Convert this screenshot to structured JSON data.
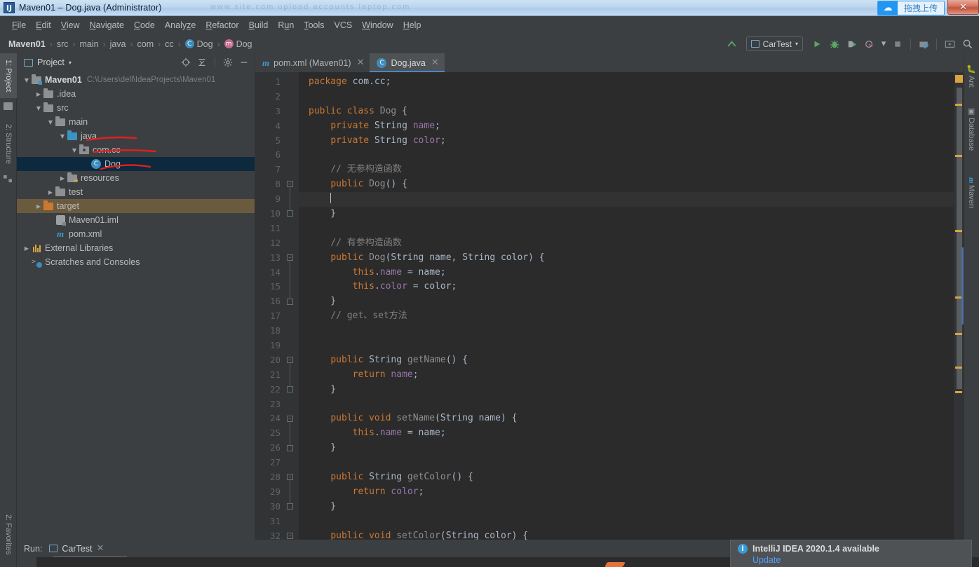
{
  "window": {
    "title": "Maven01 – Dog.java (Administrator)",
    "app_icon": "idea-icon",
    "close_label": "✕",
    "watermark": "www.site.com upload accounts laptop.com"
  },
  "upload_badge": {
    "icon": "cloud-upload-icon",
    "label": "拖拽上传"
  },
  "menubar": {
    "items": [
      {
        "label": "File",
        "accel": "F"
      },
      {
        "label": "Edit",
        "accel": "E"
      },
      {
        "label": "View",
        "accel": "V"
      },
      {
        "label": "Navigate",
        "accel": "N"
      },
      {
        "label": "Code",
        "accel": "C"
      },
      {
        "label": "Analyze",
        "accel": "z"
      },
      {
        "label": "Refactor",
        "accel": "R"
      },
      {
        "label": "Build",
        "accel": "B"
      },
      {
        "label": "Run",
        "accel": "u"
      },
      {
        "label": "Tools",
        "accel": "T"
      },
      {
        "label": "VCS",
        "accel": ""
      },
      {
        "label": "Window",
        "accel": "W"
      },
      {
        "label": "Help",
        "accel": "H"
      }
    ]
  },
  "breadcrumb": {
    "items": [
      {
        "label": "Maven01",
        "icon": "",
        "bold": true
      },
      {
        "label": "src",
        "icon": ""
      },
      {
        "label": "main",
        "icon": ""
      },
      {
        "label": "java",
        "icon": ""
      },
      {
        "label": "com",
        "icon": ""
      },
      {
        "label": "cc",
        "icon": ""
      },
      {
        "label": "Dog",
        "icon": "class-icon"
      },
      {
        "label": "Dog",
        "icon": "method-icon"
      }
    ],
    "separator": "›"
  },
  "toolbar": {
    "build_icon": "hammer-build-icon",
    "run_config": {
      "label": "CarTest",
      "icon": "run-config-icon",
      "caret": "▾"
    },
    "run_icon": "run-play-icon",
    "debug_icon": "debug-bug-icon",
    "run_coverage_icon": "run-with-coverage-icon",
    "profile_icon": "profiler-icon",
    "profile_caret": "▾",
    "stop_icon": "stop-square-icon",
    "attach_icon": "attach-debugger-icon",
    "update_icon": "update-project-icon",
    "search_icon": "search-everywhere-icon"
  },
  "left_tool_strip": {
    "tabs": [
      {
        "label": "1: Project",
        "icon": "project-icon",
        "active": true
      },
      {
        "label": "2: Structure",
        "icon": "structure-icon",
        "active": false
      }
    ],
    "bottom_tabs": [
      {
        "label": "2: Favorites",
        "icon": "favorites-icon"
      }
    ]
  },
  "right_tool_strip": {
    "tabs": [
      {
        "label": "Ant",
        "icon": "ant-icon"
      },
      {
        "label": "Database",
        "icon": "database-icon"
      },
      {
        "label": "Maven",
        "icon": "maven-icon"
      }
    ]
  },
  "project_panel": {
    "title": "Project",
    "title_caret": "▾",
    "actions": [
      {
        "name": "locate-icon",
        "glyph": "⊕"
      },
      {
        "name": "collapse-all-icon",
        "glyph": "⇥"
      },
      {
        "name": "settings-gear-icon",
        "glyph": "✾"
      },
      {
        "name": "hide-icon",
        "glyph": "—"
      }
    ],
    "tree": [
      {
        "label": "Maven01",
        "path": "C:\\Users\\dell\\IdeaProjects\\Maven01",
        "indent": 0,
        "arrow": "▼",
        "icon": "module-folder",
        "bold": true,
        "state": "normal"
      },
      {
        "label": ".idea",
        "path": "",
        "indent": 1,
        "arrow": "▶",
        "icon": "folder",
        "bold": false,
        "state": "normal"
      },
      {
        "label": "src",
        "path": "",
        "indent": 1,
        "arrow": "▼",
        "icon": "folder",
        "bold": false,
        "state": "normal"
      },
      {
        "label": "main",
        "path": "",
        "indent": 2,
        "arrow": "▼",
        "icon": "folder",
        "bold": false,
        "state": "normal"
      },
      {
        "label": "java",
        "path": "",
        "indent": 3,
        "arrow": "▼",
        "icon": "source-folder",
        "bold": false,
        "state": "normal"
      },
      {
        "label": "com.cc",
        "path": "",
        "indent": 4,
        "arrow": "▼",
        "icon": "package",
        "bold": false,
        "state": "normal"
      },
      {
        "label": "Dog",
        "path": "",
        "indent": 5,
        "arrow": "",
        "icon": "class-icon",
        "bold": false,
        "state": "selected"
      },
      {
        "label": "resources",
        "path": "",
        "indent": 3,
        "arrow": "▶",
        "icon": "resources-folder",
        "bold": false,
        "state": "normal"
      },
      {
        "label": "test",
        "path": "",
        "indent": 2,
        "arrow": "▶",
        "icon": "folder",
        "bold": false,
        "state": "normal"
      },
      {
        "label": "target",
        "path": "",
        "indent": 1,
        "arrow": "▶",
        "icon": "excluded-folder",
        "bold": false,
        "state": "highlight"
      },
      {
        "label": "Maven01.iml",
        "path": "",
        "indent": 2,
        "arrow": "",
        "icon": "iml-icon",
        "bold": false,
        "state": "normal"
      },
      {
        "label": "pom.xml",
        "path": "",
        "indent": 2,
        "arrow": "",
        "icon": "maven-pom-icon",
        "bold": false,
        "state": "normal"
      },
      {
        "label": "External Libraries",
        "path": "",
        "indent": 0,
        "arrow": "▶",
        "icon": "libraries-icon",
        "bold": false,
        "state": "normal"
      },
      {
        "label": "Scratches and Consoles",
        "path": "",
        "indent": 0,
        "arrow": "",
        "icon": "scratches-icon",
        "bold": false,
        "state": "normal"
      }
    ],
    "annotations": [
      {
        "name": "red-underline-java"
      },
      {
        "name": "red-overline-dog"
      },
      {
        "name": "red-underline-dog"
      }
    ]
  },
  "editor": {
    "tabs": [
      {
        "label": "pom.xml (Maven01)",
        "icon": "maven-pom-icon",
        "active": false,
        "close": "✕"
      },
      {
        "label": "Dog.java",
        "icon": "class-icon",
        "active": true,
        "close": "✕"
      }
    ],
    "caret_line": 9,
    "first_line": 1,
    "last_line": 32,
    "lines": [
      {
        "n": 1,
        "tokens": [
          [
            "kw",
            "package"
          ],
          [
            "pln",
            " com.cc;"
          ]
        ]
      },
      {
        "n": 2,
        "tokens": []
      },
      {
        "n": 3,
        "tokens": [
          [
            "kw",
            "public class "
          ],
          [
            "cls",
            "Dog"
          ],
          [
            "pln",
            " {"
          ]
        ]
      },
      {
        "n": 4,
        "tokens": [
          [
            "pln",
            "    "
          ],
          [
            "kw",
            "private"
          ],
          [
            "type",
            " String "
          ],
          [
            "fld",
            "name"
          ],
          [
            "pln",
            ";"
          ]
        ]
      },
      {
        "n": 5,
        "tokens": [
          [
            "pln",
            "    "
          ],
          [
            "kw",
            "private"
          ],
          [
            "type",
            " String "
          ],
          [
            "fld",
            "color"
          ],
          [
            "pln",
            ";"
          ]
        ]
      },
      {
        "n": 6,
        "tokens": []
      },
      {
        "n": 7,
        "tokens": [
          [
            "pln",
            "    "
          ],
          [
            "cmt",
            "// 无参构造函数"
          ]
        ]
      },
      {
        "n": 8,
        "tokens": [
          [
            "pln",
            "    "
          ],
          [
            "kw",
            "public "
          ],
          [
            "cls",
            "Dog"
          ],
          [
            "pln",
            "() {"
          ]
        ],
        "fold": "start"
      },
      {
        "n": 9,
        "tokens": [
          [
            "caret",
            ""
          ]
        ],
        "caret": true
      },
      {
        "n": 10,
        "tokens": [
          [
            "pln",
            "    }"
          ]
        ],
        "fold": "end"
      },
      {
        "n": 11,
        "tokens": []
      },
      {
        "n": 12,
        "tokens": [
          [
            "pln",
            "    "
          ],
          [
            "cmt",
            "// 有参构造函数"
          ]
        ]
      },
      {
        "n": 13,
        "tokens": [
          [
            "pln",
            "    "
          ],
          [
            "kw",
            "public "
          ],
          [
            "cls",
            "Dog"
          ],
          [
            "pln",
            "("
          ],
          [
            "type",
            "String"
          ],
          [
            "pln",
            " name, "
          ],
          [
            "type",
            "String"
          ],
          [
            "pln",
            " color) {"
          ]
        ],
        "fold": "start"
      },
      {
        "n": 14,
        "tokens": [
          [
            "pln",
            "        "
          ],
          [
            "kw",
            "this"
          ],
          [
            "pln",
            "."
          ],
          [
            "fld",
            "name"
          ],
          [
            "pln",
            " = name;"
          ]
        ]
      },
      {
        "n": 15,
        "tokens": [
          [
            "pln",
            "        "
          ],
          [
            "kw",
            "this"
          ],
          [
            "pln",
            "."
          ],
          [
            "fld",
            "color"
          ],
          [
            "pln",
            " = color;"
          ]
        ]
      },
      {
        "n": 16,
        "tokens": [
          [
            "pln",
            "    }"
          ]
        ],
        "fold": "end"
      },
      {
        "n": 17,
        "tokens": [
          [
            "pln",
            "    "
          ],
          [
            "cmt",
            "// get、set方法"
          ]
        ]
      },
      {
        "n": 18,
        "tokens": []
      },
      {
        "n": 19,
        "tokens": []
      },
      {
        "n": 20,
        "tokens": [
          [
            "pln",
            "    "
          ],
          [
            "kw",
            "public "
          ],
          [
            "type",
            "String "
          ],
          [
            "mth",
            "getName"
          ],
          [
            "pln",
            "() {"
          ]
        ],
        "fold": "start"
      },
      {
        "n": 21,
        "tokens": [
          [
            "pln",
            "        "
          ],
          [
            "kw",
            "return "
          ],
          [
            "fld",
            "name"
          ],
          [
            "pln",
            ";"
          ]
        ]
      },
      {
        "n": 22,
        "tokens": [
          [
            "pln",
            "    }"
          ]
        ],
        "fold": "end"
      },
      {
        "n": 23,
        "tokens": []
      },
      {
        "n": 24,
        "tokens": [
          [
            "pln",
            "    "
          ],
          [
            "kw",
            "public void "
          ],
          [
            "mth",
            "setName"
          ],
          [
            "pln",
            "("
          ],
          [
            "type",
            "String"
          ],
          [
            "pln",
            " name) {"
          ]
        ],
        "fold": "start"
      },
      {
        "n": 25,
        "tokens": [
          [
            "pln",
            "        "
          ],
          [
            "kw",
            "this"
          ],
          [
            "pln",
            "."
          ],
          [
            "fld",
            "name"
          ],
          [
            "pln",
            " = name;"
          ]
        ]
      },
      {
        "n": 26,
        "tokens": [
          [
            "pln",
            "    }"
          ]
        ],
        "fold": "end"
      },
      {
        "n": 27,
        "tokens": []
      },
      {
        "n": 28,
        "tokens": [
          [
            "pln",
            "    "
          ],
          [
            "kw",
            "public "
          ],
          [
            "type",
            "String "
          ],
          [
            "mth",
            "getColor"
          ],
          [
            "pln",
            "() {"
          ]
        ],
        "fold": "start"
      },
      {
        "n": 29,
        "tokens": [
          [
            "pln",
            "        "
          ],
          [
            "kw",
            "return "
          ],
          [
            "fld",
            "color"
          ],
          [
            "pln",
            ";"
          ]
        ]
      },
      {
        "n": 30,
        "tokens": [
          [
            "pln",
            "    }"
          ]
        ],
        "fold": "end"
      },
      {
        "n": 31,
        "tokens": []
      },
      {
        "n": 32,
        "tokens": [
          [
            "pln",
            "    "
          ],
          [
            "kw",
            "public void "
          ],
          [
            "mth",
            "setColor"
          ],
          [
            "pln",
            "("
          ],
          [
            "type",
            "String"
          ],
          [
            "pln",
            " color) {"
          ]
        ],
        "fold": "start"
      }
    ],
    "markers": {
      "color": "#d9a343",
      "positions": [
        45,
        118,
        225,
        320,
        420,
        500,
        560,
        610
      ]
    }
  },
  "run_panel": {
    "label": "Run:",
    "tab": {
      "label": "CarTest",
      "icon": "run-config-icon",
      "close": "✕"
    }
  },
  "notification": {
    "icon": "info-icon",
    "title": "IntelliJ IDEA 2020.1.4 available",
    "link": "Update"
  },
  "colors": {
    "accent_blue": "#4a88c7",
    "selection": "#0d293e",
    "highlight": "#6b5b3e",
    "keyword": "#cc7832",
    "field": "#9876aa",
    "comment": "#808080",
    "text": "#a9b7c6",
    "marker": "#d9a343",
    "editor_bg": "#2b2b2b",
    "panel_bg": "#3c3f41",
    "annotation_red": "#e02020"
  }
}
